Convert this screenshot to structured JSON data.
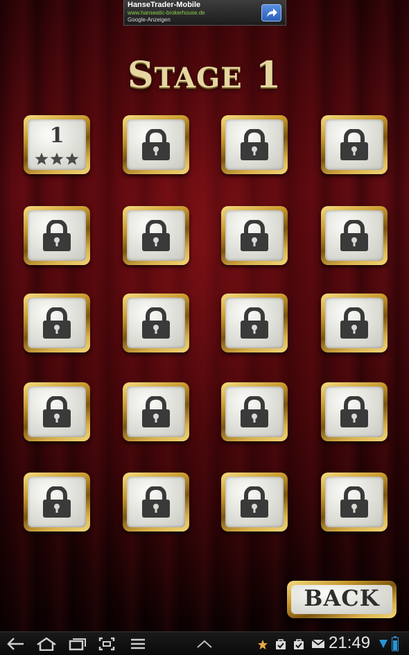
{
  "ad": {
    "title": "HanseTrader-Mobile",
    "url": "www.hanseatic-brokerhouse.de",
    "network": "Google-Anzeigen",
    "action_icon": "share-arrow-icon",
    "button_color": "#3b6fcc",
    "url_color": "#8bd14a"
  },
  "title": {
    "first_letter": "S",
    "rest": "TAGE",
    "number": "1",
    "color": "#e5d6a0"
  },
  "levels": [
    {
      "label": "1",
      "locked": false,
      "stars": 3
    },
    {
      "locked": true
    },
    {
      "locked": true
    },
    {
      "locked": true
    },
    {
      "locked": true
    },
    {
      "locked": true
    },
    {
      "locked": true
    },
    {
      "locked": true
    },
    {
      "locked": true
    },
    {
      "locked": true
    },
    {
      "locked": true
    },
    {
      "locked": true
    },
    {
      "locked": true
    },
    {
      "locked": true
    },
    {
      "locked": true
    },
    {
      "locked": true
    },
    {
      "locked": true
    },
    {
      "locked": true
    },
    {
      "locked": true
    },
    {
      "locked": true
    }
  ],
  "back_label": "BACK",
  "system_bar": {
    "nav_icons": [
      "back-nav-icon",
      "home-nav-icon",
      "recent-apps-icon",
      "screenshot-icon",
      "menu-icon"
    ],
    "center_icon": "chevron-up-icon",
    "status_icons": [
      "star-notification-icon",
      "bag-notification-icon",
      "bag-notification-icon",
      "gmail-icon",
      "wifi-icon",
      "battery-icon"
    ],
    "time": "21:49"
  },
  "colors": {
    "gold_frame": "#c99a2e",
    "tile_face": "#e4e4de",
    "lock": "#3a3a3a",
    "curtain": "#5a0a10"
  }
}
